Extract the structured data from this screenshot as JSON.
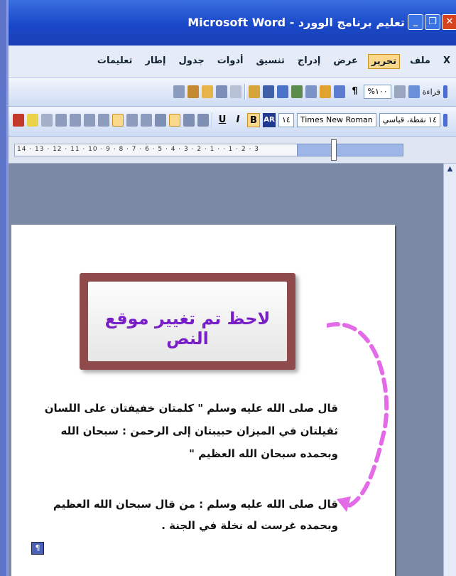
{
  "window": {
    "title": "تعليم برنامج الوورد - Microsoft Word",
    "minimize_label": "_",
    "maximize_label": "❐",
    "close_label": "✕"
  },
  "menubar": {
    "close_doc_label": "X",
    "items": [
      "ملف",
      "تحرير",
      "عرض",
      "إدراج",
      "تنسيق",
      "أدوات",
      "جدول",
      "إطار",
      "تعليمات"
    ],
    "active_index": 1
  },
  "toolbar_standard": {
    "reading_label": "قراءة",
    "zoom": "%١٠٠",
    "pilcrow": "¶"
  },
  "toolbar_formatting": {
    "style_value": "١٤ نقطة، قياسي",
    "font_value": "Times New Roman",
    "size_value": "١٤",
    "ar_label": "AR",
    "bold": "B",
    "italic": "I",
    "underline": "U"
  },
  "ruler": {
    "ticks_text": "14 · 13 · 12 · 11 · 10 · 9 · 8 · 7 · 6 · 5 · 4 · 3 · 2 · 1 · · 1 · 2 · 3"
  },
  "callout": {
    "text": "لاحظ تم تغيير موقع النص",
    "color": "#7a1fc8",
    "border_color": "#8f4b4b"
  },
  "document": {
    "paragraph1": "قال صلى الله عليه وسلم \" كلمتان خفيفتان على اللسان ثقيلتان في الميزان حبيبتان إلى الرحمن : سبحان الله وبحمده سبحان الله العظيم \"",
    "paragraph2": "قال صلى الله عليه وسلم : من قال  سبحان الله العظيم وبحمده غرست له نخلة في الجنة ."
  },
  "colors": {
    "title_bar": "#1948c9",
    "arrow": "#e36be8",
    "menu_highlight": "#fbd88b"
  }
}
